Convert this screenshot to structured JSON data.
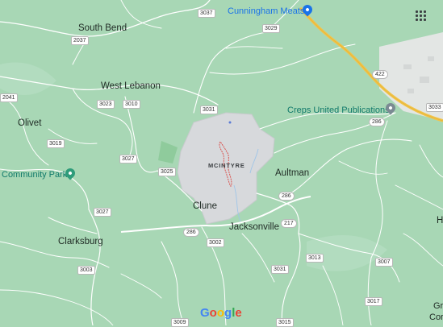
{
  "map": {
    "type": "road map",
    "colors": {
      "land": "#a8d7b5",
      "road": "#ffffff",
      "highway": "#f5c542",
      "highlighted_area": "#d7d9dc",
      "outline": "#d9534f",
      "water": "#9fc5e8",
      "urban": "#e6e8e6"
    }
  },
  "places": {
    "south_bend": "South Bend",
    "west_lebanon": "West Lebanon",
    "olivet": "Olivet",
    "community_park": "Community Park",
    "clune": "Clune",
    "jacksonville": "Jacksonville",
    "aultman": "Aultman",
    "clarksburg": "Clarksburg",
    "mcintyre": "MCINTYRE",
    "cunningham_meats": "Cunningham Meats",
    "creps_united": "Creps United Publications",
    "edge_h": "H",
    "edge_gr": "Gr",
    "edge_cor": "Cor"
  },
  "routes": {
    "r3037": "3037",
    "r3029": "3029",
    "r2037": "2037",
    "r2041": "2041",
    "r3031a": "3031",
    "r3023": "3023",
    "r3010": "3010",
    "r3019": "3019",
    "r3027a": "3027",
    "r3025": "3025",
    "r3027b": "3027",
    "r286a": "286",
    "r3002": "3002",
    "r217": "217",
    "r286b": "286",
    "r286c": "286",
    "r422": "422",
    "r3033": "3033",
    "r3003": "3003",
    "r3031b": "3031",
    "r3013": "3013",
    "r3007": "3007",
    "r3017": "3017",
    "r3009": "3009",
    "r3015": "3015"
  },
  "icons": {
    "apps": "apps-grid-icon",
    "cunningham_pin": "shopping-pin-icon",
    "creps_pin": "business-pin-icon",
    "park_pin": "park-pin-icon"
  },
  "logo": {
    "text": "Google",
    "colors": [
      "#4285f4",
      "#ea4335",
      "#fbbc05",
      "#4285f4",
      "#34a853",
      "#ea4335"
    ]
  }
}
